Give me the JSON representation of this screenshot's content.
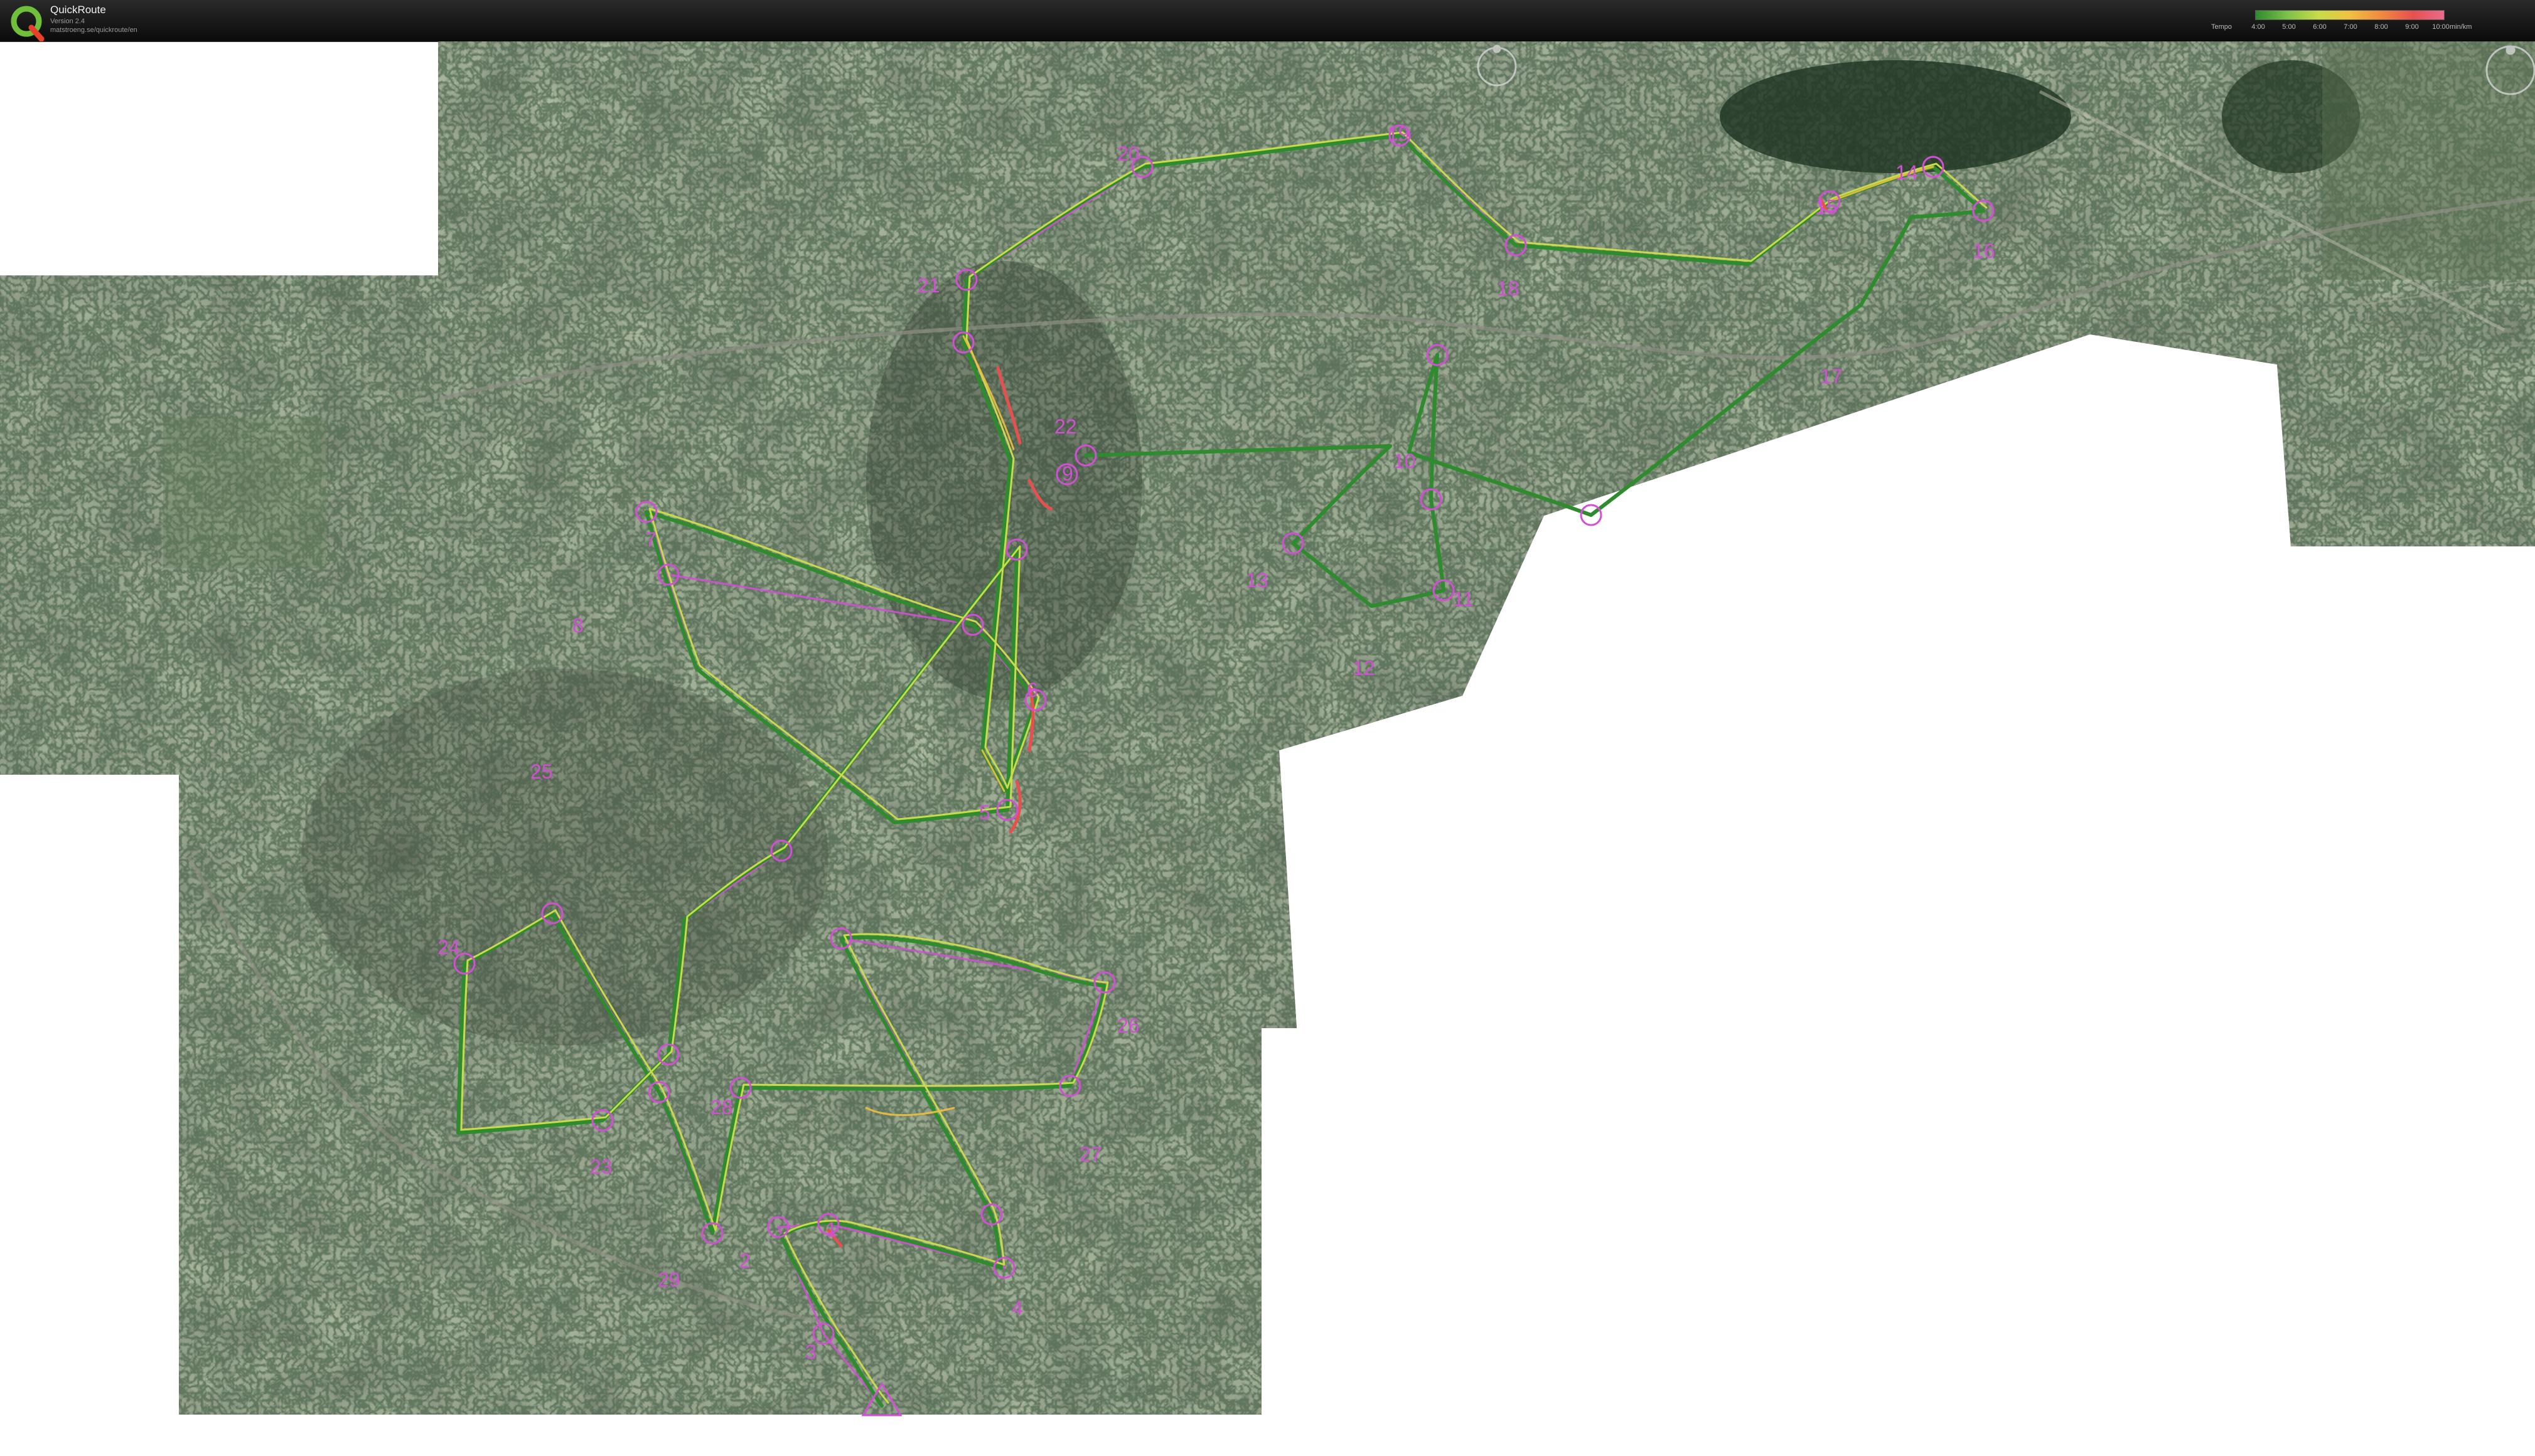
{
  "app": {
    "title": "QuickRoute",
    "version": "Version 2.4",
    "url": "matstroeng.se/quickroute/en"
  },
  "legend": {
    "label": "Tempo",
    "ticks": [
      "4:00",
      "5:00",
      "6:00",
      "7:00",
      "8:00",
      "9:00",
      "10:00"
    ],
    "unit": "min/km",
    "colors": [
      "#2e8b2e",
      "#7cc04a",
      "#c8dc4a",
      "#f0c040",
      "#f08a40",
      "#e85050",
      "#e86a8a"
    ]
  },
  "map": {
    "type": "orienteering-route-on-satellite-image",
    "course_color": "#d34fd6",
    "route_colors": [
      "#2e8b2e",
      "#c8dc4a",
      "#f0c040",
      "#e85050"
    ],
    "controls": [
      "1",
      "2",
      "3",
      "4",
      "5",
      "6",
      "7",
      "8",
      "9",
      "10",
      "11",
      "12",
      "13",
      "14",
      "15",
      "16",
      "17",
      "18",
      "19",
      "20",
      "21",
      "22",
      "23",
      "24",
      "25",
      "26",
      "27",
      "28",
      "29"
    ]
  }
}
